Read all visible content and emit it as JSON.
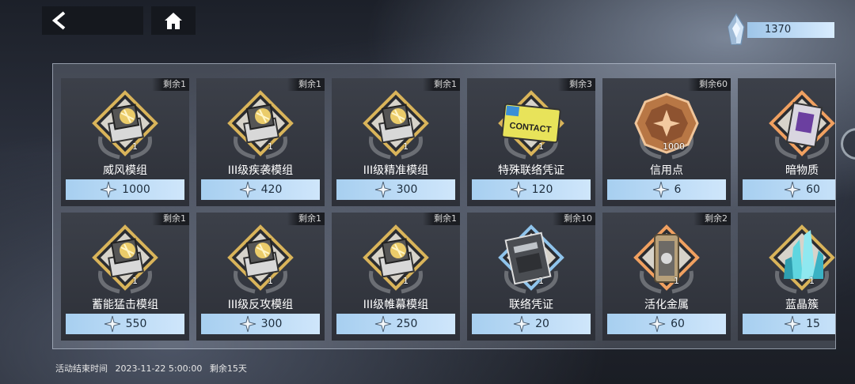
{
  "nav": {
    "back_icon": "chevron-left-icon",
    "home_icon": "home-icon"
  },
  "currency": {
    "icon": "crystal-icon",
    "amount": "1370"
  },
  "price_icon": "star-crystal-icon",
  "items": [
    {
      "name": "威风模组",
      "remaining": "剩余1",
      "qty": "1",
      "price": "1000",
      "frame": "gold",
      "icon": "module-icon"
    },
    {
      "name": "III级疾袭模组",
      "remaining": "剩余1",
      "qty": "1",
      "price": "420",
      "frame": "gold",
      "icon": "module-icon"
    },
    {
      "name": "III级精准模组",
      "remaining": "剩余1",
      "qty": "1",
      "price": "300",
      "frame": "gold",
      "icon": "module-icon"
    },
    {
      "name": "特殊联络凭证",
      "remaining": "剩余3",
      "qty": "1",
      "price": "120",
      "frame": "gold",
      "icon": "contact-card-icon",
      "card_text": "CONTACT"
    },
    {
      "name": "信用点",
      "remaining": "剩余60",
      "qty": "1000",
      "price": "6",
      "frame": "none",
      "icon": "credit-coin-icon"
    },
    {
      "name": "暗物质",
      "remaining": "",
      "qty": "",
      "price": "60",
      "frame": "orange",
      "icon": "dark-matter-icon"
    },
    {
      "name": "蓄能猛击模组",
      "remaining": "剩余1",
      "qty": "1",
      "price": "550",
      "frame": "gold",
      "icon": "module-icon"
    },
    {
      "name": "III级反攻模组",
      "remaining": "剩余1",
      "qty": "1",
      "price": "300",
      "frame": "gold",
      "icon": "module-icon"
    },
    {
      "name": "III级帷幕模组",
      "remaining": "剩余1",
      "qty": "1",
      "price": "250",
      "frame": "gold",
      "icon": "module-icon"
    },
    {
      "name": "联络凭证",
      "remaining": "剩余10",
      "qty": "1",
      "price": "20",
      "frame": "blue",
      "icon": "contact-pass-icon"
    },
    {
      "name": "活化金属",
      "remaining": "剩余2",
      "qty": "1",
      "price": "60",
      "frame": "orange",
      "icon": "activated-metal-icon"
    },
    {
      "name": "蓝晶簇",
      "remaining": "",
      "qty": "1",
      "price": "15",
      "frame": "gold",
      "icon": "blue-crystal-icon"
    }
  ],
  "footer": {
    "label": "活动结束时间",
    "datetime": "2023-11-22 5:00:00",
    "remaining": "剩余15天"
  },
  "colors": {
    "gold": "#d9b45a",
    "orange": "#f0a060",
    "blue": "#8fc4ec",
    "price_bar": "#a7cff0"
  }
}
